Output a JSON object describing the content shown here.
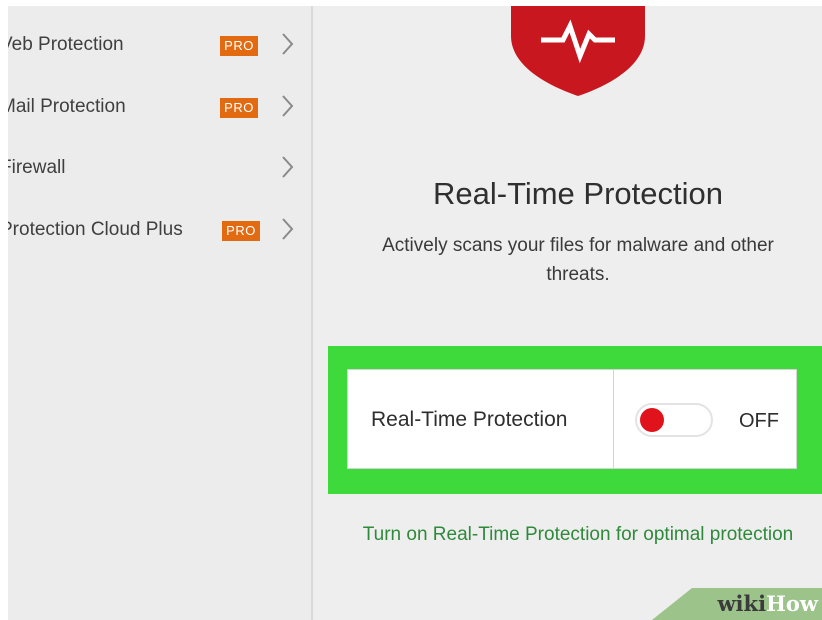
{
  "sidebar": {
    "items": [
      {
        "label": "Veb Protection",
        "pro": true
      },
      {
        "label": "Mail Protection",
        "pro": true
      },
      {
        "label": "Firewall",
        "pro": false
      },
      {
        "label": "Protection Cloud Plus",
        "pro": true
      }
    ],
    "pro_label": "PRO"
  },
  "main": {
    "title": "Real-Time Protection",
    "description": "Actively scans your files for malware and other threats.",
    "setting": {
      "label": "Real-Time Protection",
      "state": "OFF"
    },
    "hint": "Turn on Real-Time Protection for optimal protection"
  },
  "colors": {
    "shield": "#c8171e",
    "toggle_knob": "#e0121b",
    "pro_badge": "#e26b12",
    "highlight": "#3ed93a",
    "hint_text": "#2e8a3a"
  },
  "icons": {
    "shield": "shield-heartbeat-icon",
    "chevron": "chevron-right-icon"
  },
  "watermark": {
    "part1": "wiki",
    "part2": "How"
  }
}
